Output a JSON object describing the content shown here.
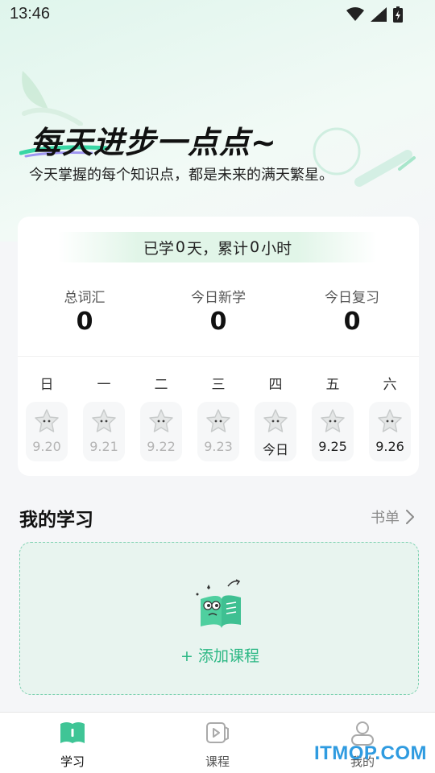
{
  "status": {
    "time": "13:46"
  },
  "hero": {
    "title": "每天进步一点点~",
    "subtitle": "今天掌握的每个知识点，都是未来的满天繁星。"
  },
  "summary": {
    "learned_prefix": "已学",
    "learned_days": "0",
    "learned_mid": "天，累计",
    "learned_hours": "0",
    "learned_suffix": "小时",
    "stats": [
      {
        "label": "总词汇",
        "value": "0"
      },
      {
        "label": "今日新学",
        "value": "0"
      },
      {
        "label": "今日复习",
        "value": "0"
      }
    ]
  },
  "week": [
    {
      "name": "日",
      "date": "9.20",
      "state": "past"
    },
    {
      "name": "一",
      "date": "9.21",
      "state": "past"
    },
    {
      "name": "二",
      "date": "9.22",
      "state": "past"
    },
    {
      "name": "三",
      "date": "9.23",
      "state": "past"
    },
    {
      "name": "四",
      "date": "今日",
      "state": "today"
    },
    {
      "name": "五",
      "date": "9.25",
      "state": "future"
    },
    {
      "name": "六",
      "date": "9.26",
      "state": "future"
    }
  ],
  "my_study": {
    "title": "我的学习",
    "booklist_label": "书单",
    "add_course_label": "+ 添加课程"
  },
  "tabs": [
    {
      "label": "学习",
      "icon": "book-icon",
      "active": true
    },
    {
      "label": "课程",
      "icon": "video-icon",
      "active": false
    },
    {
      "label": "我的",
      "icon": "profile-icon",
      "active": false
    }
  ],
  "watermark": "ITMOP.COM",
  "colors": {
    "accent": "#2db885",
    "watermark": "#2f9be0"
  }
}
